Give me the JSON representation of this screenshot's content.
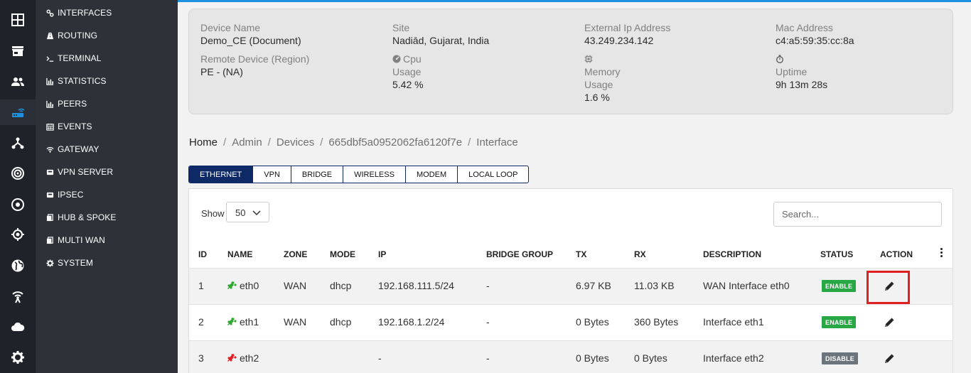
{
  "theme": {
    "accent": "#1e90e0",
    "navy": "#0d2a66",
    "enable_color": "#28a745",
    "disable_color": "#6c757d",
    "plug_up_color": "#2ea82e",
    "plug_down_color": "#e02020",
    "highlight_color": "#e02020"
  },
  "rail": {
    "icons": [
      "grid-icon",
      "store-icon",
      "users-icon",
      "router-icon",
      "network-icon",
      "radar-icon",
      "target-icon",
      "crosshair-icon",
      "globe-icon",
      "antenna-icon",
      "cloud-icon",
      "settings-icon"
    ],
    "active": "router-icon"
  },
  "menu": {
    "items": [
      {
        "label": "INTERFACES",
        "icon": "link-icon"
      },
      {
        "label": "ROUTING",
        "icon": "road-icon"
      },
      {
        "label": "TERMINAL",
        "icon": "terminal-icon"
      },
      {
        "label": "STATISTICS",
        "icon": "bar-chart-icon"
      },
      {
        "label": "PEERS",
        "icon": "bar-chart-icon"
      },
      {
        "label": "EVENTS",
        "icon": "calendar-icon"
      },
      {
        "label": "GATEWAY",
        "icon": "wifi-icon"
      },
      {
        "label": "VPN SERVER",
        "icon": "server-icon"
      },
      {
        "label": "IPSEC",
        "icon": "server-icon"
      },
      {
        "label": "HUB & SPOKE",
        "icon": "copy-icon"
      },
      {
        "label": "MULTI WAN",
        "icon": "copy-icon"
      },
      {
        "label": "SYSTEM",
        "icon": "gear-icon"
      }
    ]
  },
  "device": {
    "name_label": "Device Name",
    "name_value": "Demo_CE (Document)",
    "remote_label": "Remote Device (Region)",
    "remote_value": "PE - (NA)",
    "site_label": "Site",
    "site_value": "Nadiād, Gujarat, India",
    "cpu_label": "Cpu",
    "cpu_usage_label": "Usage",
    "cpu_usage_value": "5.42 %",
    "ext_ip_label": "External Ip Address",
    "ext_ip_value": "43.249.234.142",
    "memory_label": "Memory",
    "memory_usage_label": "Usage",
    "memory_usage_value": "1.6 %",
    "mac_label": "Mac Address",
    "mac_value": "c4:a5:59:35:cc:8a",
    "uptime_label": "Uptime",
    "uptime_value": "9h 13m 28s"
  },
  "breadcrumb": [
    "Home",
    "Admin",
    "Devices",
    "665dbf5a0952062fa6120f7e",
    "Interface"
  ],
  "tabs": [
    {
      "label": "ETHERNET",
      "active": true
    },
    {
      "label": "VPN",
      "active": false
    },
    {
      "label": "BRIDGE",
      "active": false
    },
    {
      "label": "WIRELESS",
      "active": false
    },
    {
      "label": "MODEM",
      "active": false
    },
    {
      "label": "LOCAL LOOP",
      "active": false
    }
  ],
  "controls": {
    "show_label": "Show",
    "page_size": "50",
    "search_placeholder": "Search..."
  },
  "table": {
    "columns": [
      "ID",
      "NAME",
      "ZONE",
      "MODE",
      "IP",
      "BRIDGE GROUP",
      "TX",
      "RX",
      "DESCRIPTION",
      "STATUS",
      "ACTION"
    ],
    "rows": [
      {
        "id": "1",
        "name": "eth0",
        "link": "up",
        "zone": "WAN",
        "mode": "dhcp",
        "ip": "192.168.111.5/24",
        "bridge": "-",
        "tx": "6.97 KB",
        "rx": "11.03 KB",
        "description": "WAN Interface eth0",
        "status": "ENABLE",
        "highlighted": true
      },
      {
        "id": "2",
        "name": "eth1",
        "link": "up",
        "zone": "WAN",
        "mode": "dhcp",
        "ip": "192.168.1.2/24",
        "bridge": "-",
        "tx": "0 Bytes",
        "rx": "360 Bytes",
        "description": "Interface eth1",
        "status": "ENABLE",
        "highlighted": false
      },
      {
        "id": "3",
        "name": "eth2",
        "link": "down",
        "zone": "",
        "mode": "",
        "ip": "-",
        "bridge": "-",
        "tx": "0 Bytes",
        "rx": "0 Bytes",
        "description": "Interface eth2",
        "status": "DISABLE",
        "highlighted": false
      }
    ]
  }
}
